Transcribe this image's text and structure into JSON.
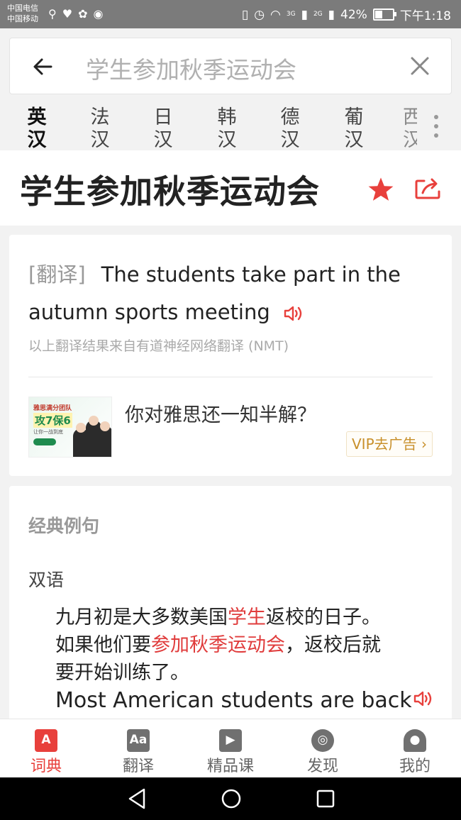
{
  "status_bar": {
    "carrier_1": "中国电信",
    "carrier_2": "中国移动",
    "network_1": "3G",
    "network_2": "2G",
    "battery": "42%",
    "battery_level": 0.42,
    "time": "下午1:18"
  },
  "search": {
    "query": "学生参加秋季运动会"
  },
  "languages": [
    {
      "top": "英",
      "bottom": "汉"
    },
    {
      "top": "法",
      "bottom": "汉"
    },
    {
      "top": "日",
      "bottom": "汉"
    },
    {
      "top": "韩",
      "bottom": "汉"
    },
    {
      "top": "德",
      "bottom": "汉"
    },
    {
      "top": "葡",
      "bottom": "汉"
    },
    {
      "top": "西",
      "bottom": "汉"
    }
  ],
  "header": {
    "title": "学生参加秋季运动会"
  },
  "translation": {
    "tag": "[翻译]",
    "text": "The students take part in the autumn sports meeting",
    "source": "以上翻译结果来自有道神经网络翻译 (NMT)"
  },
  "ad": {
    "image_caption_top": "雅思满分团队",
    "image_caption_big": "攻7保6",
    "image_caption_small": "让你一战到底",
    "text": "你对雅思还一知半解？",
    "vip_label": "VIP去广告",
    "vip_arrow": "›"
  },
  "examples": {
    "section_title": "经典例句",
    "subsection": "双语",
    "items": [
      {
        "cn_parts": [
          "九月初是大多数美国",
          "学生",
          "返校的日子。如果他们要",
          "参加秋季运动会",
          "，返校后就要开始训练了。"
        ],
        "en": "Most American students are back"
      }
    ]
  },
  "bottom_nav": [
    {
      "label": "词典",
      "glyph": "A",
      "icon": "dictionary-icon"
    },
    {
      "label": "翻译",
      "glyph": "Aa",
      "icon": "translate-icon"
    },
    {
      "label": "精品课",
      "glyph": "▶",
      "icon": "course-icon"
    },
    {
      "label": "发现",
      "glyph": "◎",
      "icon": "discover-icon"
    },
    {
      "label": "我的",
      "glyph": "●",
      "icon": "profile-icon"
    }
  ],
  "colors": {
    "accent": "#e8403c",
    "vip": "#c8902b",
    "status_bar": "#7b7b7b"
  }
}
